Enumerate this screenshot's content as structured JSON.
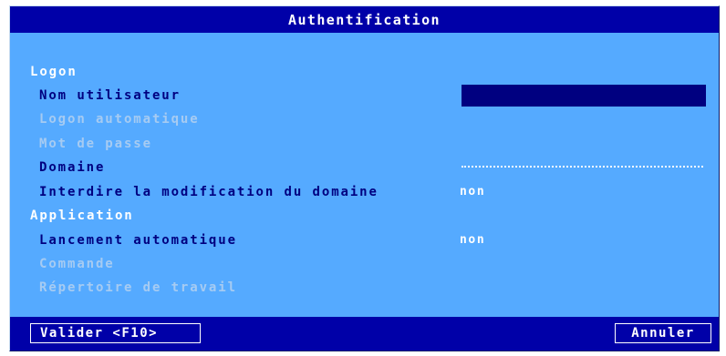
{
  "window": {
    "title": "Authentification"
  },
  "sections": {
    "logon": "Logon",
    "application": "Application"
  },
  "fields": {
    "nom_utilisateur": {
      "label": "Nom utilisateur",
      "value": ""
    },
    "logon_automatique": {
      "label": "Logon automatique"
    },
    "mot_de_passe": {
      "label": "Mot de passe"
    },
    "domaine": {
      "label": "Domaine"
    },
    "interdire_modif_domaine": {
      "label": "Interdire la modification du domaine",
      "value": "non"
    },
    "lancement_automatique": {
      "label": "Lancement automatique",
      "value": "non"
    },
    "commande": {
      "label": "Commande"
    },
    "repertoire_travail": {
      "label": "Répertoire de travail"
    }
  },
  "buttons": {
    "validate": "Valider <F10>",
    "cancel": "Annuler"
  },
  "colors": {
    "dialog_bg": "#55aaff",
    "titlebar_bg": "#0000a8",
    "active_label": "#000080",
    "disabled_label": "#a6cbf2",
    "input_bg": "#000080"
  }
}
